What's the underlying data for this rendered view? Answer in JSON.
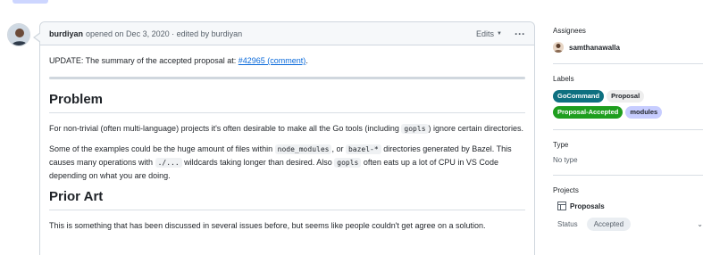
{
  "comment": {
    "author": "burdiyan",
    "meta": "opened on Dec 3, 2020 · edited by burdiyan",
    "edits_label": "Edits",
    "more_label": "···",
    "update_text": "UPDATE: The summary of the accepted proposal at: ",
    "update_link": "#42965 (comment)",
    "update_end": ".",
    "heading_problem": "Problem",
    "p1_a": "For non-trivial (often multi-language) projects it's often desirable to make all the Go tools (including ",
    "p1_code": "gopls",
    "p1_b": ") ignore certain directories.",
    "p2_a": "Some of the examples could be the huge amount of files within ",
    "p2_code1": "node_modules",
    "p2_b": ", or ",
    "p2_code2": "bazel-*",
    "p2_c": " directories generated by Bazel. This causes many operations with ",
    "p2_code3": "./...",
    "p2_d": " wildcards taking longer than desired. Also ",
    "p2_code4": "gopls",
    "p2_e": " often eats up a lot of CPU in VS Code depending on what you are doing.",
    "heading_prior": "Prior Art",
    "p3": "This is something that has been discussed in several issues before, but seems like people couldn't get agree on a solution."
  },
  "sidebar": {
    "assignees_title": "Assignees",
    "assignee": "samthanawalla",
    "labels_title": "Labels",
    "labels": [
      {
        "text": "GoCommand",
        "bg": "#0e7080",
        "fg": "#ffffff"
      },
      {
        "text": "Proposal",
        "bg": "#eeeeee",
        "fg": "#1f2328"
      },
      {
        "text": "Proposal-Accepted",
        "bg": "#1e9e1e",
        "fg": "#ffffff"
      },
      {
        "text": "modules",
        "bg": "#c7cdff",
        "fg": "#1f2328"
      }
    ],
    "type_title": "Type",
    "type_value": "No type",
    "projects_title": "Projects",
    "project_name": "Proposals",
    "status_label": "Status",
    "status_value": "Accepted"
  }
}
